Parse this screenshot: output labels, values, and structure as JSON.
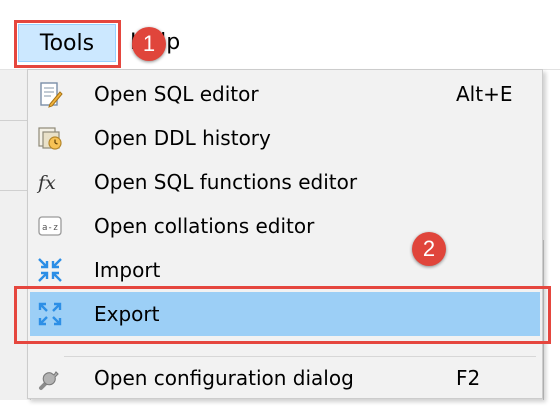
{
  "menubar": {
    "tools_label": "Tools",
    "help_label": "Help"
  },
  "badges": {
    "step1": "1",
    "step2": "2"
  },
  "tools_menu": {
    "items": [
      {
        "label": "Open SQL editor",
        "shortcut": "Alt+E",
        "icon": "sql-editor-icon"
      },
      {
        "label": "Open DDL history",
        "shortcut": "",
        "icon": "ddl-history-icon"
      },
      {
        "label": "Open SQL functions editor",
        "shortcut": "",
        "icon": "fx-icon"
      },
      {
        "label": "Open collations editor",
        "shortcut": "",
        "icon": "collations-icon"
      },
      {
        "label": "Import",
        "shortcut": "",
        "icon": "import-icon"
      },
      {
        "label": "Export",
        "shortcut": "",
        "icon": "export-icon",
        "active": true
      },
      {
        "label": "Open configuration dialog",
        "shortcut": "F2",
        "icon": "wrench-icon"
      }
    ]
  },
  "colors": {
    "highlight_border": "#e5463e",
    "badge": "#e0453b",
    "active_item": "#9ccff6",
    "menubar_active": "#cce8ff"
  }
}
